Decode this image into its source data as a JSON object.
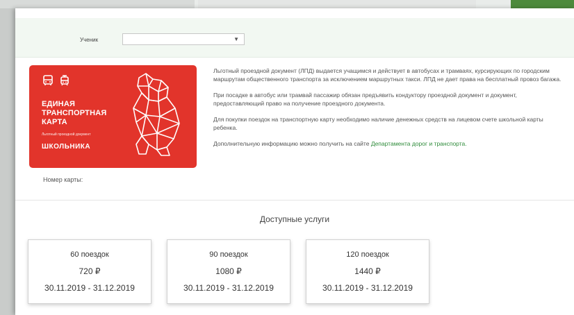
{
  "filter": {
    "student_label": "Ученик",
    "student_value": ""
  },
  "card": {
    "title_lines": [
      "ЕДИНАЯ",
      "ТРАНСПОРТНАЯ",
      "КАРТА"
    ],
    "subtitle_small": "Льготный проездной документ",
    "school": "ШКОЛЬНИКА",
    "bg_color": "#e2342b",
    "icons": [
      "bus-icon",
      "tram-icon",
      "bear-logo-icon"
    ]
  },
  "card_number_label": "Номер карты:",
  "info": {
    "p1": "Льготный проездной документ (ЛПД) выдается учащимся и действует в автобусах и трамваях, курсирующих по городским маршрутам общественного транспорта за исключением маршрутных такси. ЛПД не дает права на бесплатный провоз багажа.",
    "p2": "При посадке в автобус или трамвай пассажир обязан предъявить кондуктору проездной документ и документ, предоставляющий право на получение проездного документа.",
    "p3": "Для покупки поездок на транспортную карту необходимо наличие денежных средств на лицевом счете школьной карты ребенка.",
    "p4_prefix": "Дополнительную информацию можно получить на сайте ",
    "p4_link": "Департамента дорог и транспорта."
  },
  "services": {
    "title": "Доступные услуги",
    "items": [
      {
        "trips": "60 поездок",
        "price": "720 ₽",
        "dates": "30.11.2019 - 31.12.2019"
      },
      {
        "trips": "90 поездок",
        "price": "1080 ₽",
        "dates": "30.11.2019 - 31.12.2019"
      },
      {
        "trips": "120 поездок",
        "price": "1440 ₽",
        "dates": "30.11.2019 - 31.12.2019"
      }
    ]
  },
  "colors": {
    "accent_green": "#2e8b3a",
    "top_bar_bg": "#f2f8f2"
  }
}
